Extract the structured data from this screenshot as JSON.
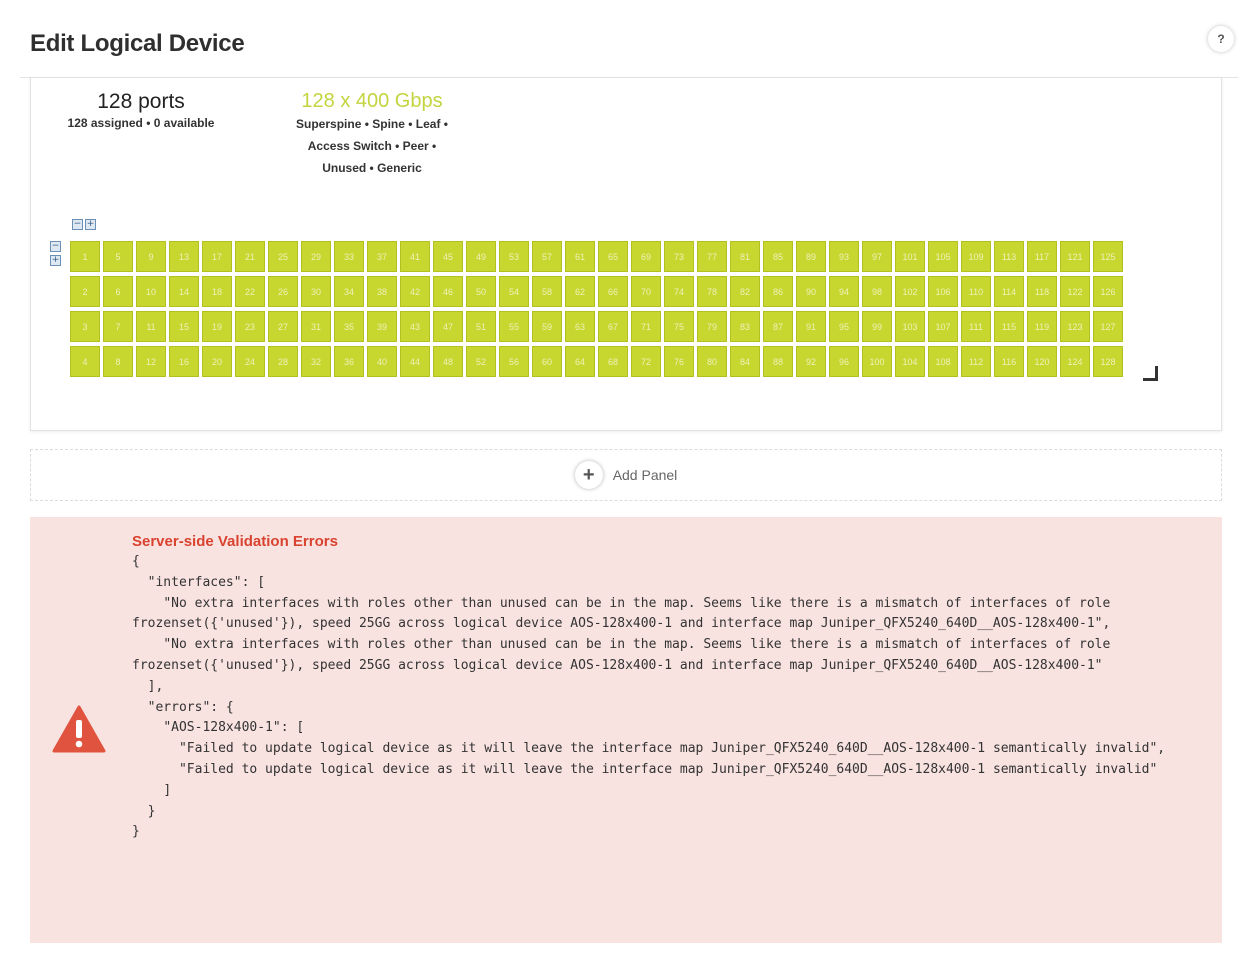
{
  "header": {
    "title": "Edit Logical Device",
    "help_label": "?"
  },
  "panel": {
    "ports_count": "128 ports",
    "ports_assigned": "128 assigned • 0 available",
    "speed_label": "128 x 400 Gbps",
    "roles_line1": "Superspine • Spine • Leaf •",
    "roles_line2": "Access Switch • Peer •",
    "roles_line3": "Unused • Generic",
    "port_numbers": [
      [
        "1",
        "5",
        "9",
        "13",
        "17",
        "21",
        "25",
        "29",
        "33",
        "37",
        "41",
        "45",
        "49",
        "53",
        "57",
        "61",
        "65",
        "69",
        "73",
        "77",
        "81",
        "85",
        "89",
        "93",
        "97",
        "101",
        "105",
        "109",
        "113",
        "117",
        "121",
        "125"
      ],
      [
        "2",
        "6",
        "10",
        "14",
        "18",
        "22",
        "26",
        "30",
        "34",
        "38",
        "42",
        "46",
        "50",
        "54",
        "58",
        "62",
        "66",
        "70",
        "74",
        "78",
        "82",
        "86",
        "90",
        "94",
        "98",
        "102",
        "106",
        "110",
        "114",
        "118",
        "122",
        "126"
      ],
      [
        "3",
        "7",
        "11",
        "15",
        "19",
        "23",
        "27",
        "31",
        "35",
        "39",
        "43",
        "47",
        "51",
        "55",
        "59",
        "63",
        "67",
        "71",
        "75",
        "79",
        "83",
        "87",
        "91",
        "95",
        "99",
        "103",
        "107",
        "111",
        "115",
        "119",
        "123",
        "127"
      ],
      [
        "4",
        "8",
        "12",
        "16",
        "20",
        "24",
        "28",
        "32",
        "36",
        "40",
        "44",
        "48",
        "52",
        "56",
        "60",
        "64",
        "68",
        "72",
        "76",
        "80",
        "84",
        "88",
        "92",
        "96",
        "100",
        "104",
        "108",
        "112",
        "116",
        "120",
        "124",
        "128"
      ]
    ],
    "port_color": "#c8d630"
  },
  "add_panel": {
    "label": "Add Panel"
  },
  "validation": {
    "title": "Server-side Validation Errors",
    "body": "{\n  \"interfaces\": [\n    \"No extra interfaces with roles other than unused can be in the map. Seems like there is a mismatch of interfaces of role frozenset({'unused'}), speed 25GG across logical device AOS-128x400-1 and interface map Juniper_QFX5240_640D__AOS-128x400-1\",\n    \"No extra interfaces with roles other than unused can be in the map. Seems like there is a mismatch of interfaces of role frozenset({'unused'}), speed 25GG across logical device AOS-128x400-1 and interface map Juniper_QFX5240_640D__AOS-128x400-1\"\n  ],\n  \"errors\": {\n    \"AOS-128x400-1\": [\n      \"Failed to update logical device as it will leave the interface map Juniper_QFX5240_640D__AOS-128x400-1 semantically invalid\",\n      \"Failed to update logical device as it will leave the interface map Juniper_QFX5240_640D__AOS-128x400-1 semantically invalid\"\n    ]\n  }\n}",
    "error_color": "#d9432f"
  }
}
